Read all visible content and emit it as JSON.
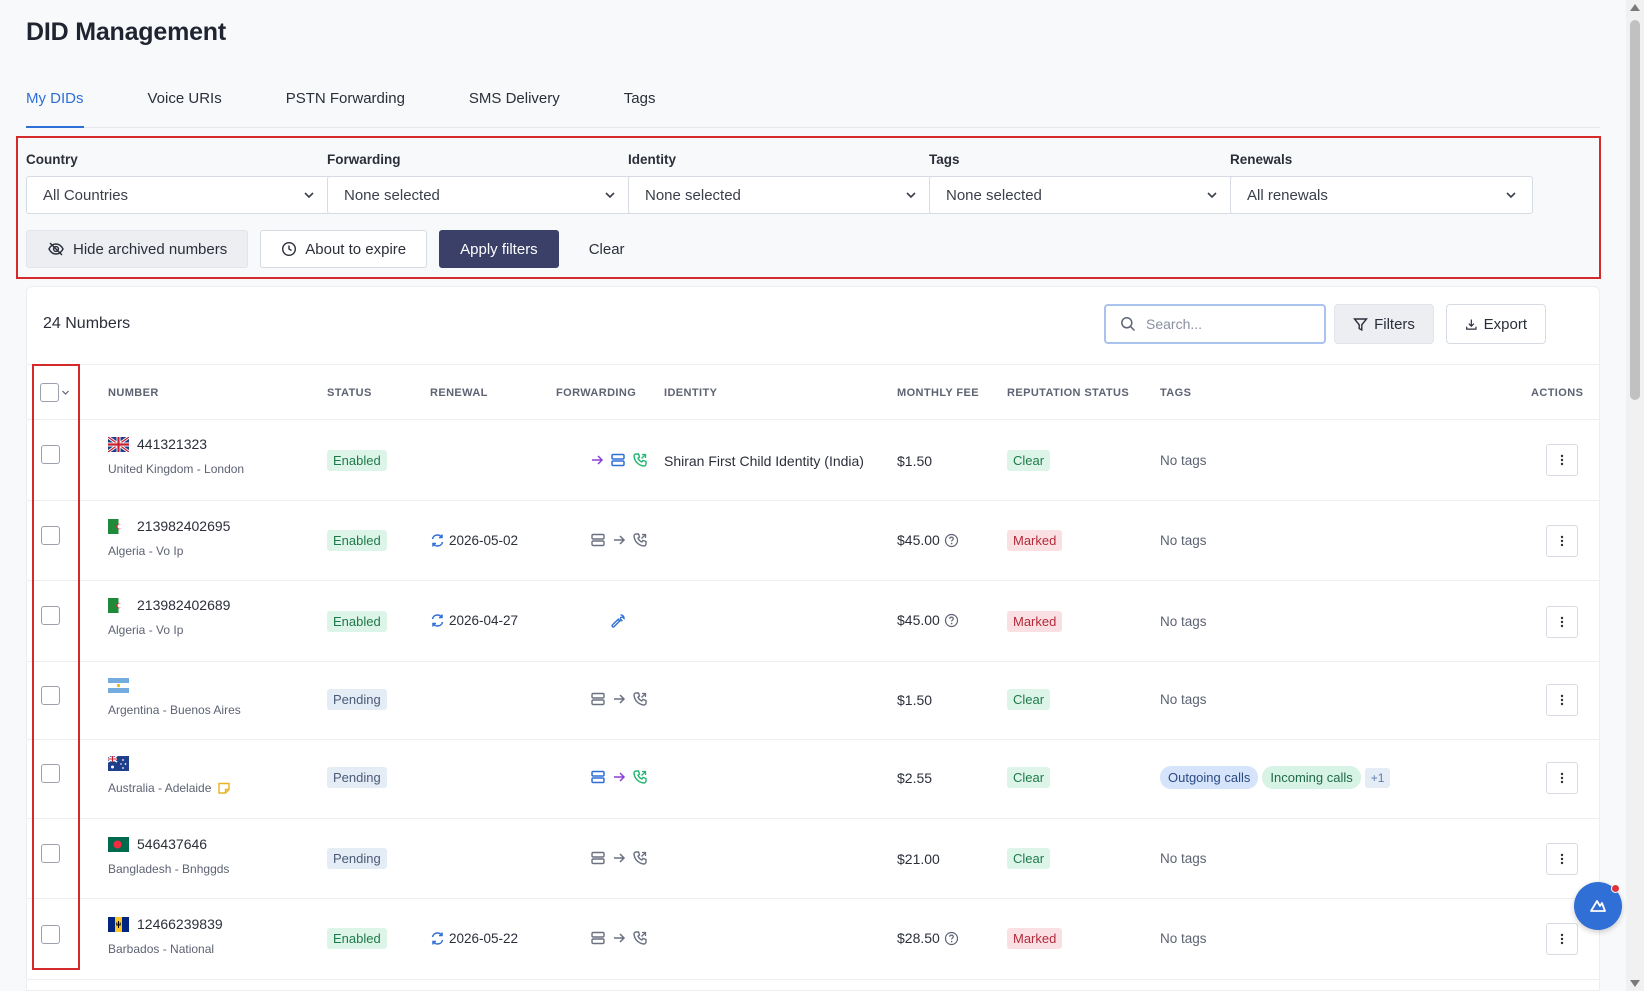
{
  "page": {
    "title": "DID Management"
  },
  "tabs": [
    {
      "label": "My DIDs",
      "active": true
    },
    {
      "label": "Voice URIs",
      "active": false
    },
    {
      "label": "PSTN Forwarding",
      "active": false
    },
    {
      "label": "SMS Delivery",
      "active": false
    },
    {
      "label": "Tags",
      "active": false
    }
  ],
  "filters": {
    "country": {
      "label": "Country",
      "value": "All Countries"
    },
    "forwarding": {
      "label": "Forwarding",
      "value": "None selected"
    },
    "identity": {
      "label": "Identity",
      "value": "None selected"
    },
    "tags": {
      "label": "Tags",
      "value": "None selected"
    },
    "renewals": {
      "label": "Renewals",
      "value": "All renewals"
    },
    "hide_archived_label": "Hide archived numbers",
    "about_to_expire_label": "About to expire",
    "apply_label": "Apply filters",
    "clear_label": "Clear"
  },
  "table": {
    "count_label": "24 Numbers",
    "search_placeholder": "Search...",
    "filters_label": "Filters",
    "export_label": "Export",
    "columns": {
      "number": "NUMBER",
      "status": "STATUS",
      "renewal": "RENEWAL",
      "forwarding": "FORWARDING",
      "identity": "IDENTITY",
      "monthly_fee": "MONTHLY FEE",
      "reputation": "REPUTATION STATUS",
      "tags": "TAGS",
      "actions": "ACTIONS"
    },
    "rows": [
      {
        "number": "441321323",
        "location": "United Kingdom - London",
        "flag": "uk-flag",
        "status": "Enabled",
        "renewal": "",
        "forwarding": "colored-arrow-server-phone",
        "identity": "Shiran First Child Identity (India)",
        "fee": "$1.50",
        "fee_help": false,
        "reputation": "Clear",
        "tags": "No tags"
      },
      {
        "number": "213982402695",
        "location": "Algeria - Vo Ip",
        "flag": "algeria-flag",
        "status": "Enabled",
        "renewal": "2026-05-02",
        "forwarding": "gray-server-arrow-phone",
        "identity": "",
        "fee": "$45.00",
        "fee_help": true,
        "reputation": "Marked",
        "tags": "No tags"
      },
      {
        "number": "213982402689",
        "location": "Algeria - Vo Ip",
        "flag": "algeria-flag",
        "status": "Enabled",
        "renewal": "2026-04-27",
        "forwarding": "wrench",
        "identity": "",
        "fee": "$45.00",
        "fee_help": true,
        "reputation": "Marked",
        "tags": "No tags"
      },
      {
        "number": "",
        "location": "Argentina - Buenos Aires",
        "flag": "argentina-flag",
        "status": "Pending",
        "renewal": "",
        "forwarding": "gray-server-arrow-phone",
        "identity": "",
        "fee": "$1.50",
        "fee_help": false,
        "reputation": "Clear",
        "tags": "No tags"
      },
      {
        "number": "",
        "location": "Australia - Adelaide",
        "flag": "australia-flag",
        "status": "Pending",
        "renewal": "",
        "forwarding": "colored-server-arrow-phone",
        "identity": "",
        "fee": "$2.55",
        "fee_help": false,
        "reputation": "Clear",
        "tags": "",
        "tag_list": [
          "Outgoing calls",
          "Incoming calls"
        ],
        "tag_more": "+1"
      },
      {
        "number": "546437646",
        "location": "Bangladesh - Bnhggds",
        "flag": "bangladesh-flag",
        "status": "Pending",
        "renewal": "",
        "forwarding": "gray-server-arrow-phone",
        "identity": "",
        "fee": "$21.00",
        "fee_help": false,
        "reputation": "Clear",
        "tags": "No tags"
      },
      {
        "number": "12466239839",
        "location": "Barbados - National",
        "flag": "barbados-flag",
        "status": "Enabled",
        "renewal": "2026-05-22",
        "forwarding": "gray-server-arrow-phone",
        "identity": "",
        "fee": "$28.50",
        "fee_help": true,
        "reputation": "Marked",
        "tags": "No tags"
      }
    ]
  },
  "colors": {
    "accent": "#2f6fd6",
    "apply_button": "#3a4068",
    "highlight_box": "#d42a2a"
  }
}
